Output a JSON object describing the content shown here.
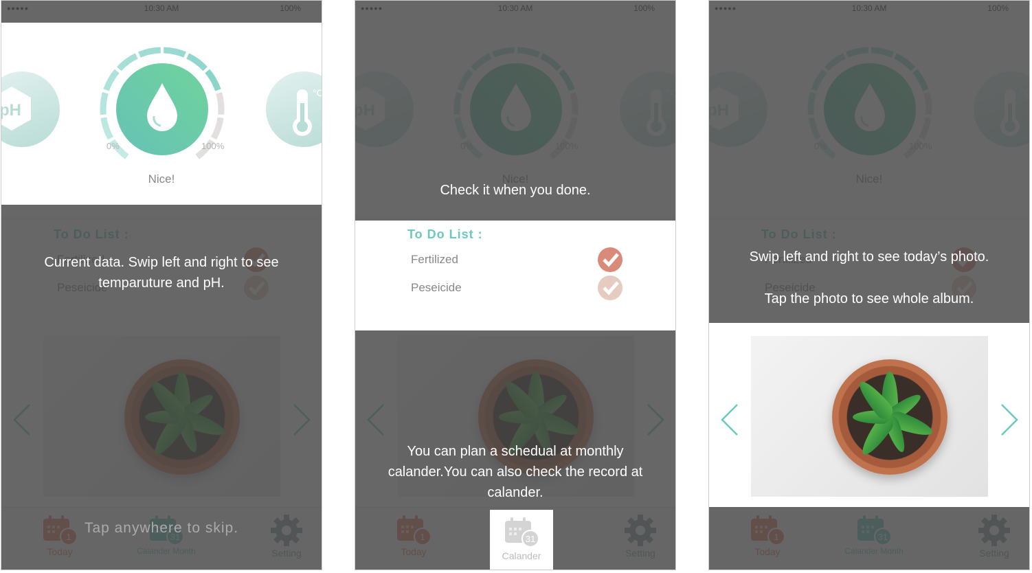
{
  "status_bar": {
    "time": "10:30 AM",
    "battery": "100%"
  },
  "sensor": {
    "moisture_level": 0.75,
    "min_label": "0%",
    "max_label": "100%",
    "status": "Nice!",
    "ph_label": "pH",
    "temp_unit": "°C"
  },
  "todo": {
    "title": "To Do List :",
    "items": [
      {
        "label": "Fertilized",
        "checked": true
      },
      {
        "label": "Peseicide",
        "checked": false
      }
    ]
  },
  "tabs": [
    {
      "label": "Today",
      "badge": "1"
    },
    {
      "label": "Calander Month",
      "badge": "31"
    },
    {
      "label": "Setting"
    }
  ],
  "highlight_calendar": {
    "label": "Calander",
    "badge": "31"
  },
  "tips": {
    "panel1": "Current data. Swip left and right to see temparuture and pH.",
    "skip": "Tap anywhere to skip.",
    "panel2_top": "Check it when you done.",
    "panel2_bottom": "You can plan a schedual at monthly calander.You can also check the record at calander.",
    "panel3_line1": "Swip left and right to see today’s photo.",
    "panel3_line2": "Tap the photo to see whole album."
  },
  "colors": {
    "accent": "#6ccabd",
    "check_on": "#d98a78",
    "check_off": "#e6cbc1",
    "today": "#e07a5f"
  }
}
